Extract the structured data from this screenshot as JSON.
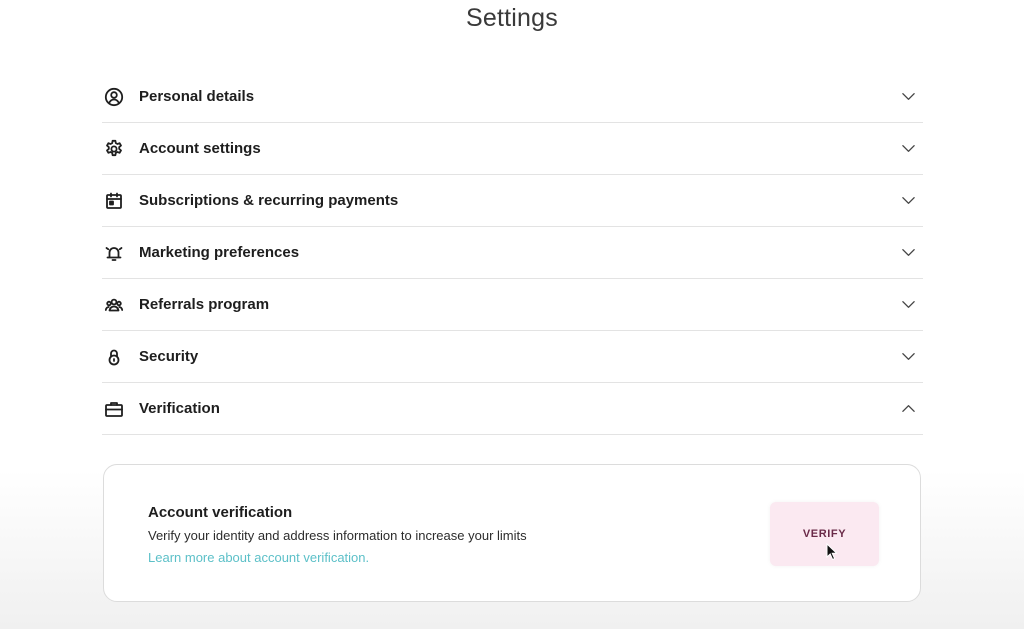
{
  "page": {
    "title": "Settings"
  },
  "sections": [
    {
      "label": "Personal details",
      "icon": "user-circle-icon",
      "expanded": false
    },
    {
      "label": "Account settings",
      "icon": "gear-icon",
      "expanded": false
    },
    {
      "label": "Subscriptions & recurring payments",
      "icon": "calendar-icon",
      "expanded": false
    },
    {
      "label": "Marketing preferences",
      "icon": "bell-icon",
      "expanded": false
    },
    {
      "label": "Referrals program",
      "icon": "people-icon",
      "expanded": false
    },
    {
      "label": "Security",
      "icon": "lock-icon",
      "expanded": false
    },
    {
      "label": "Verification",
      "icon": "briefcase-icon",
      "expanded": true
    }
  ],
  "verification_card": {
    "title": "Account verification",
    "description": "Verify your identity and address information to increase your limits",
    "link": "Learn more about account verification.",
    "button_label": "VERIFY"
  },
  "colors": {
    "link": "#5cc0c8",
    "button_bg": "#fbe9f1",
    "button_text": "#6a2a48",
    "divider": "#e3e3e3"
  }
}
